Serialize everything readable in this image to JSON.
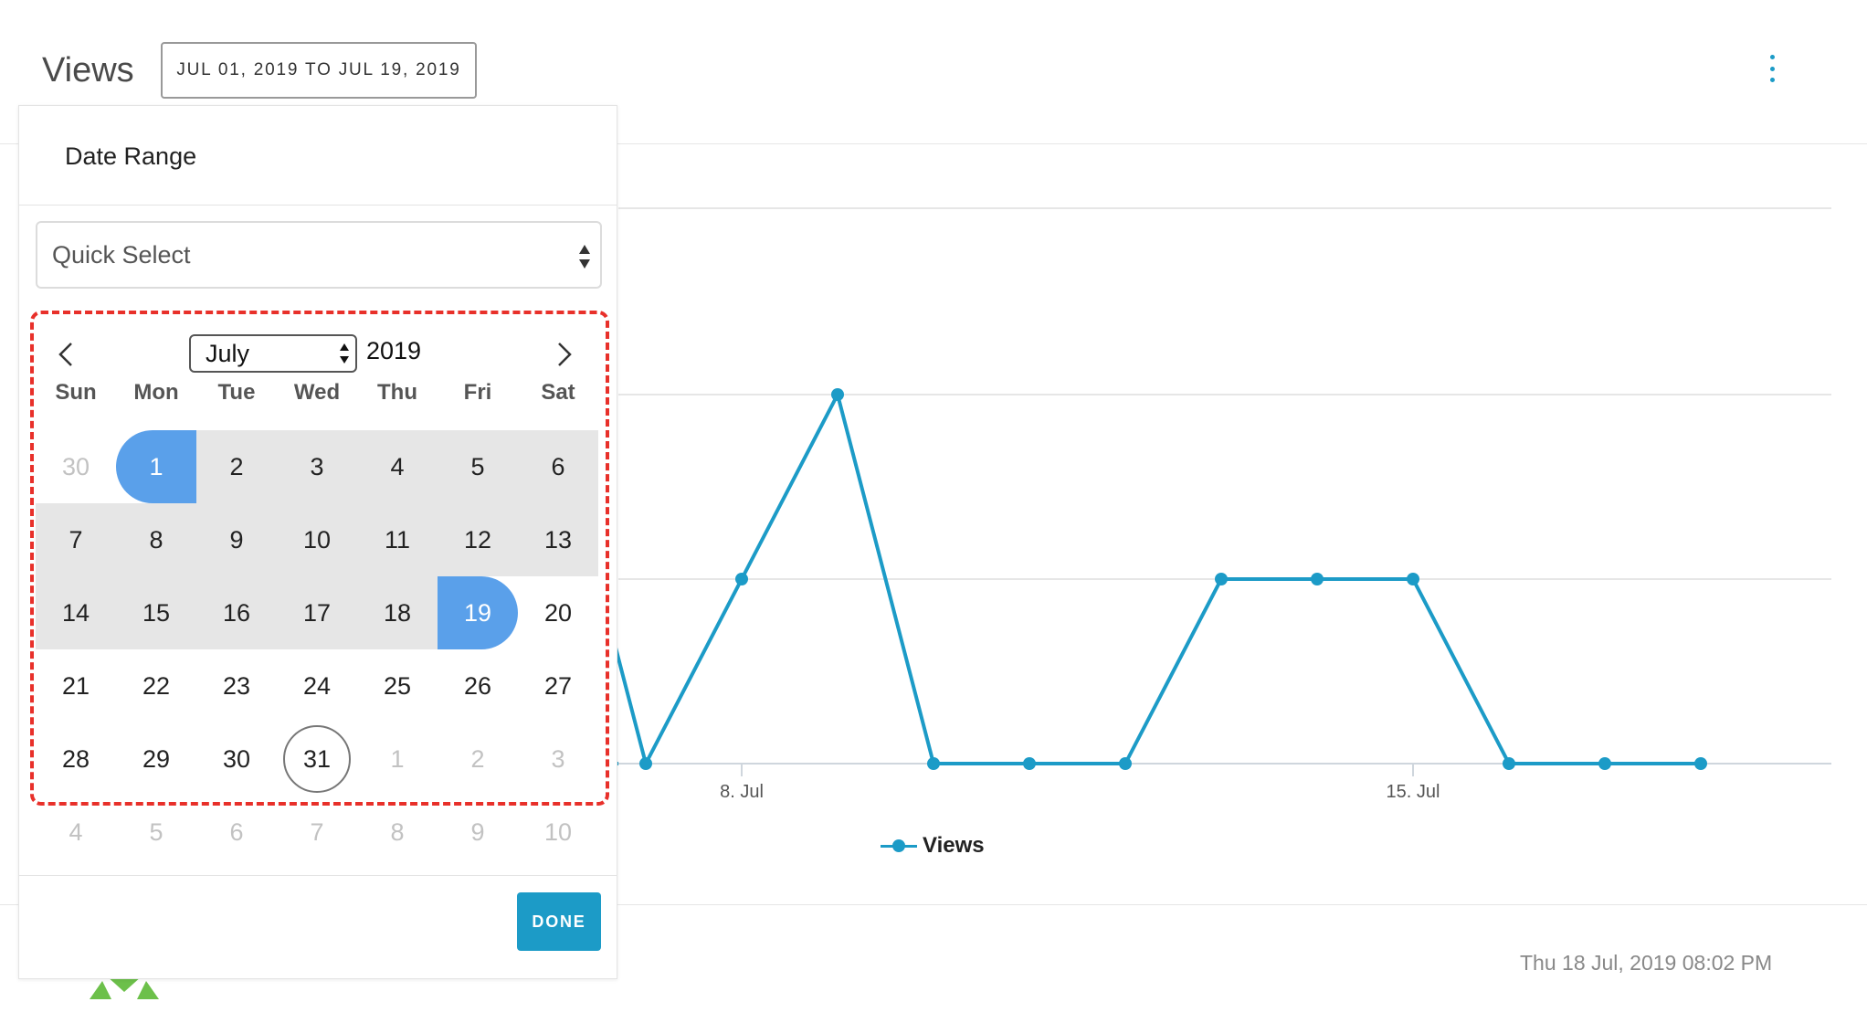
{
  "header": {
    "title": "Views",
    "range_label": "JUL 01, 2019 TO JUL 19, 2019"
  },
  "date_picker": {
    "title": "Date Range",
    "quick_select_value": "Quick Select",
    "month_value": "July",
    "year": "2019",
    "weekdays": [
      "Sun",
      "Mon",
      "Tue",
      "Wed",
      "Thu",
      "Fri",
      "Sat"
    ],
    "weeks": [
      [
        "30",
        "1",
        "2",
        "3",
        "4",
        "5",
        "6"
      ],
      [
        "7",
        "8",
        "9",
        "10",
        "11",
        "12",
        "13"
      ],
      [
        "14",
        "15",
        "16",
        "17",
        "18",
        "19",
        "20"
      ],
      [
        "21",
        "22",
        "23",
        "24",
        "25",
        "26",
        "27"
      ],
      [
        "28",
        "29",
        "30",
        "31",
        "1",
        "2",
        "3"
      ],
      [
        "4",
        "5",
        "6",
        "7",
        "8",
        "9",
        "10"
      ]
    ],
    "selected_start": "1",
    "selected_end": "19",
    "today": "31",
    "done_label": "DONE"
  },
  "chart_data": {
    "type": "line",
    "series": [
      {
        "name": "Views",
        "x": [
          "2019-07-04",
          "2019-07-05",
          "2019-07-06",
          "2019-07-07",
          "2019-07-08",
          "2019-07-09",
          "2019-07-10",
          "2019-07-11",
          "2019-07-12",
          "2019-07-13",
          "2019-07-14",
          "2019-07-15",
          "2019-07-16",
          "2019-07-17",
          "2019-07-18"
        ],
        "values": [
          0,
          1,
          2,
          0,
          1,
          2,
          0,
          0,
          0,
          1,
          1,
          1,
          0,
          0,
          0
        ]
      }
    ],
    "x_ticks": [
      "8. Jul",
      "15. Jul"
    ],
    "ylim": [
      0,
      2
    ],
    "legend": "bottom-center",
    "grid": true,
    "color": "#1c9bc7"
  },
  "footer": {
    "timestamp": "Thu 18 Jul, 2019 08:02 PM"
  },
  "colors": {
    "accent": "#1c9bc7",
    "range_selected": "#5aa0ea",
    "range_fill": "#e6e6e6",
    "highlight_outline": "#e8302a"
  }
}
